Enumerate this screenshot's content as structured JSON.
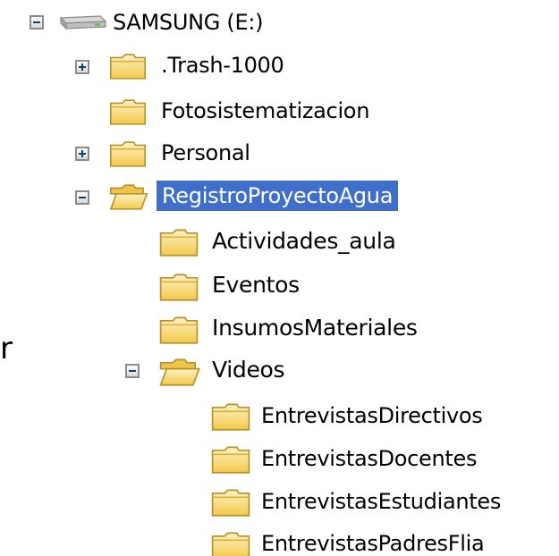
{
  "tree": {
    "drive": {
      "label": "SAMSUNG (E:)",
      "icon": "drive-icon",
      "expanded": true
    },
    "items": [
      {
        "label": ".Trash-1000",
        "icon": "folder-icon",
        "expander": "plus"
      },
      {
        "label": "Fotosistematizacion",
        "icon": "folder-icon",
        "expander": "none"
      },
      {
        "label": "Personal",
        "icon": "folder-icon",
        "expander": "plus"
      },
      {
        "label": "RegistroProyectoAgua",
        "icon": "folder-open-icon",
        "expander": "minus",
        "selected": true
      },
      {
        "label": "Actividades_aula",
        "icon": "folder-icon",
        "expander": "none"
      },
      {
        "label": "Eventos",
        "icon": "folder-icon",
        "expander": "none"
      },
      {
        "label": "InsumosMateriales",
        "icon": "folder-icon",
        "expander": "none"
      },
      {
        "label": "Videos",
        "icon": "folder-open-icon",
        "expander": "minus"
      },
      {
        "label": "EntrevistasDirectivos",
        "icon": "folder-icon",
        "expander": "none"
      },
      {
        "label": "EntrevistasDocentes",
        "icon": "folder-icon",
        "expander": "none"
      },
      {
        "label": "EntrevistasEstudiantes",
        "icon": "folder-icon",
        "expander": "none"
      },
      {
        "label": "EntrevistasPadresFlia",
        "icon": "folder-icon",
        "expander": "none"
      }
    ]
  },
  "stray_text": "r",
  "colors": {
    "selection": "#3f6fc9",
    "selection_text": "#ffffff",
    "folder_fill": "#f6d776",
    "folder_outline": "#b8912a"
  }
}
